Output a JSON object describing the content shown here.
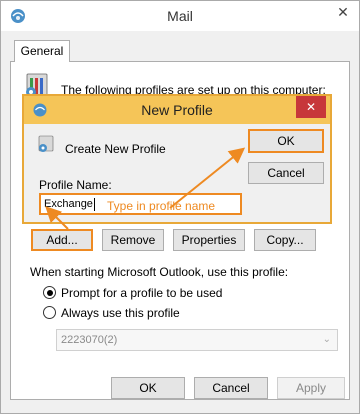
{
  "mail_window": {
    "title": "Mail",
    "close_glyph": "✕",
    "tabs": [
      {
        "label": "General"
      }
    ],
    "profiles_text": "The following profiles are set up on this computer:",
    "buttons": {
      "add": "Add...",
      "remove": "Remove",
      "properties": "Properties",
      "copy": "Copy..."
    },
    "startup_label": "When starting Microsoft Outlook, use this profile:",
    "radio_prompt": "Prompt for a profile to be used",
    "radio_always": "Always use this profile",
    "selected_profile": "2223070(2)",
    "footer": {
      "ok": "OK",
      "cancel": "Cancel",
      "apply": "Apply"
    }
  },
  "new_profile_dialog": {
    "title": "New Profile",
    "close_glyph": "✕",
    "create_label": "Create New Profile",
    "ok_label": "OK",
    "cancel_label": "Cancel",
    "profile_name_label": "Profile Name:",
    "profile_name_value": "Exchange",
    "hint": "Type in profile name"
  },
  "colors": {
    "highlight_orange": "#ee8a22",
    "dialog_title_bg": "#f5c558",
    "close_red": "#c7373a"
  }
}
